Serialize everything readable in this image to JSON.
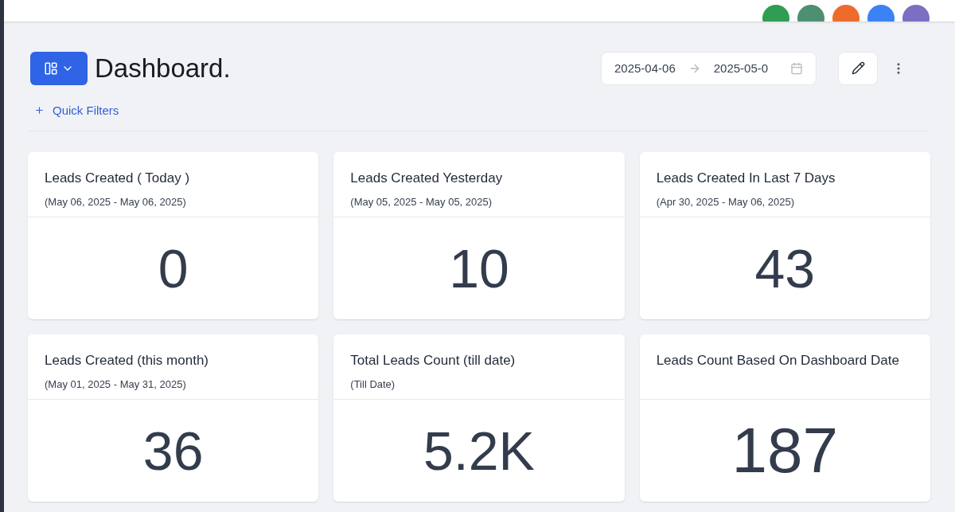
{
  "header": {
    "avatars": [
      {
        "color": "#2f9e52"
      },
      {
        "color": "#4e8f72"
      },
      {
        "color": "#ee6b2c"
      },
      {
        "color": "#3b82f6"
      },
      {
        "color": "#7a6fc2"
      }
    ]
  },
  "page": {
    "title": "Dashboard.",
    "quick_filters": "Quick Filters",
    "date_range": {
      "start": "2025-04-06",
      "end": "2025-05-0"
    }
  },
  "cards": [
    {
      "title": "Leads Created ( Today )",
      "subtitle": "(May 06, 2025 - May 06, 2025)",
      "value": "0"
    },
    {
      "title": "Leads Created Yesterday",
      "subtitle": "(May 05, 2025 - May 05, 2025)",
      "value": "10"
    },
    {
      "title": "Leads Created In Last 7 Days",
      "subtitle": "(Apr 30, 2025 - May 06, 2025)",
      "value": "43"
    },
    {
      "title": "Leads Created (this month)",
      "subtitle": "(May 01, 2025 - May 31, 2025)",
      "value": "36"
    },
    {
      "title": "Total Leads Count (till date)",
      "subtitle": "(Till Date)",
      "value": "5.2K"
    },
    {
      "title": "Leads Count Based On Dashboard Date",
      "value": "187"
    }
  ]
}
